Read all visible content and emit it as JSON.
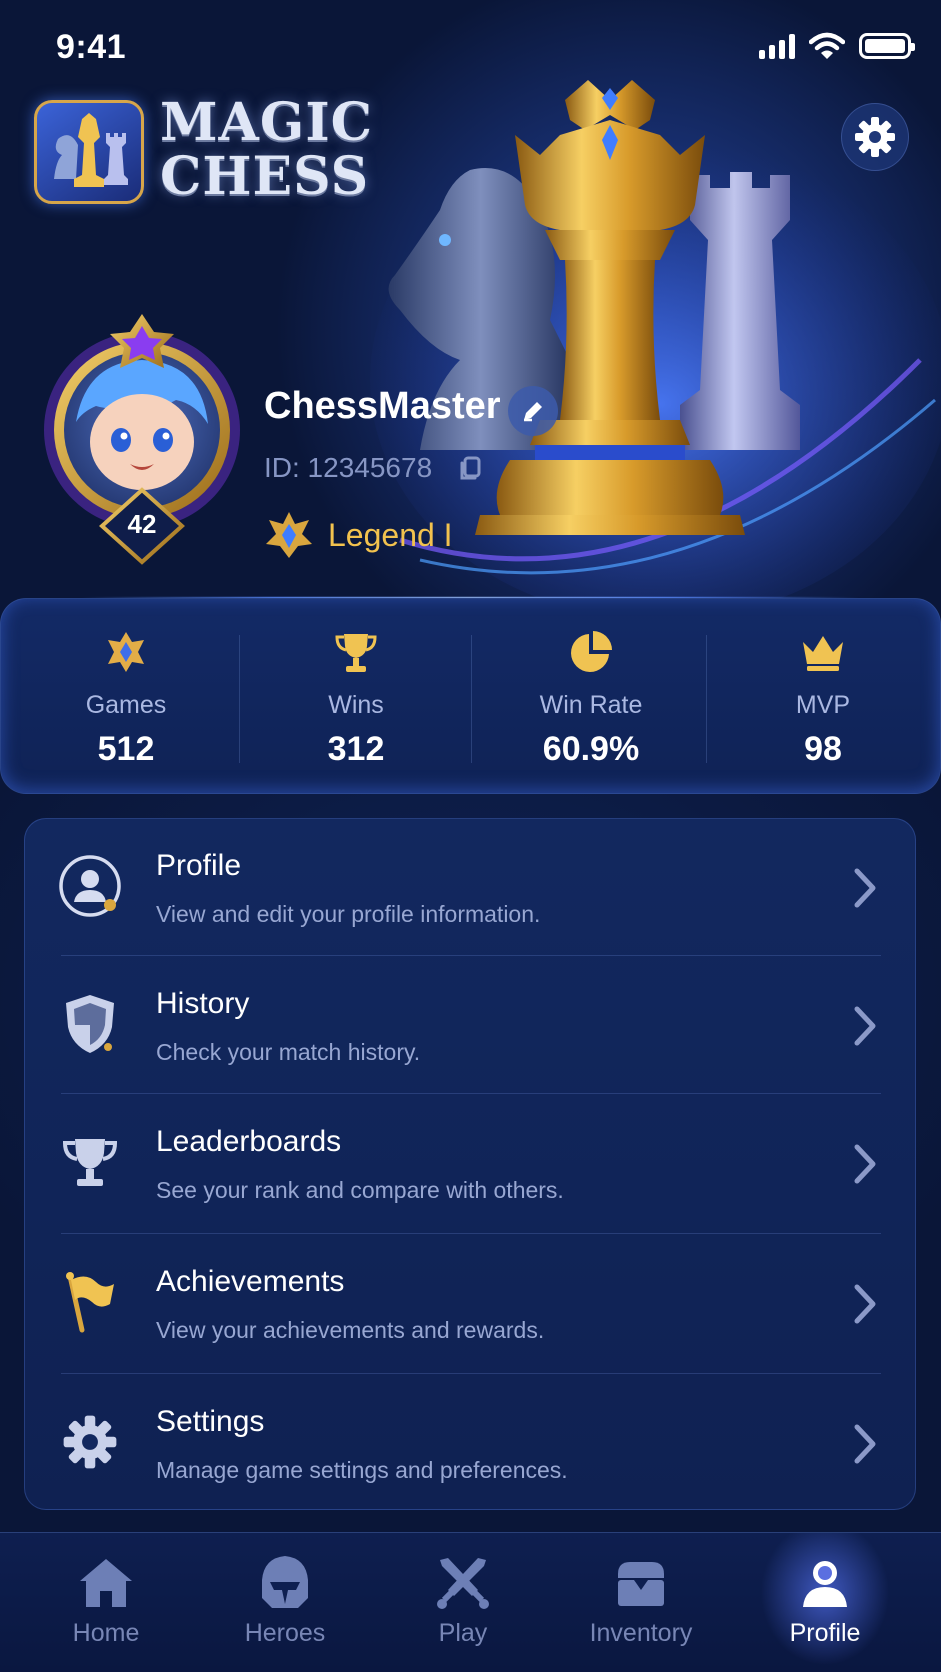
{
  "status_bar": {
    "time": "9:41"
  },
  "header": {
    "logo_line1": "MAGIC",
    "logo_line2": "CHESS"
  },
  "player": {
    "name": "ChessMaster",
    "id_text": "ID: 12345678",
    "level": "42",
    "rank": "Legend I"
  },
  "stats": [
    {
      "icon": "diamond-emblem-icon",
      "label": "Games",
      "value": "512"
    },
    {
      "icon": "trophy-icon",
      "label": "Wins",
      "value": "312"
    },
    {
      "icon": "pie-chart-icon",
      "label": "Win Rate",
      "value": "60.9%"
    },
    {
      "icon": "crown-icon",
      "label": "MVP",
      "value": "98"
    }
  ],
  "menu": [
    {
      "icon": "user-circle-icon",
      "title": "Profile",
      "subtitle": "View and edit your profile information."
    },
    {
      "icon": "shield-icon",
      "title": "History",
      "subtitle": "Check your match history."
    },
    {
      "icon": "trophy-cup-icon",
      "title": "Leaderboards",
      "subtitle": "See your rank and compare with others."
    },
    {
      "icon": "flag-icon",
      "title": "Achievements",
      "subtitle": "View your achievements and rewards."
    },
    {
      "icon": "gear-icon",
      "title": "Settings",
      "subtitle": "Manage game settings and preferences."
    }
  ],
  "nav": [
    {
      "icon": "home-icon",
      "label": "Home"
    },
    {
      "icon": "helmet-icon",
      "label": "Heroes"
    },
    {
      "icon": "crossed-swords-icon",
      "label": "Play"
    },
    {
      "icon": "chest-icon",
      "label": "Inventory"
    },
    {
      "icon": "user-icon",
      "label": "Profile",
      "active": true
    }
  ],
  "colors": {
    "accent_gold": "#f2c24e",
    "background": "#0a1638",
    "card": "#12285f"
  }
}
